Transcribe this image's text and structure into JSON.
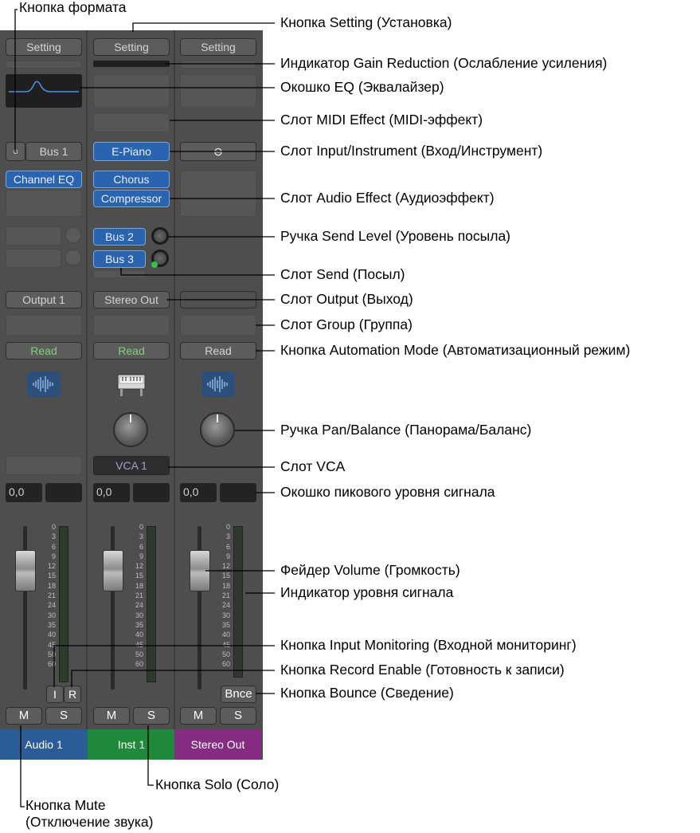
{
  "strips": [
    {
      "setting": "Setting",
      "input_toggle": "○",
      "input": "Bus 1",
      "audio_effects": [
        "Channel EQ"
      ],
      "sends": [],
      "output": "Output 1",
      "automation": "Read",
      "peak": "0,0",
      "input_monitor": "I",
      "record_enable": "R",
      "mute": "M",
      "solo": "S",
      "name": "Audio 1",
      "name_color": "#2b5c97",
      "icon": "waveform-icon"
    },
    {
      "setting": "Setting",
      "input": "E-Piano",
      "audio_effects": [
        "Chorus",
        "Compressor"
      ],
      "sends": [
        "Bus 2",
        "Bus 3"
      ],
      "output": "Stereo Out",
      "automation": "Read",
      "vca": "VCA 1",
      "peak": "0,0",
      "mute": "M",
      "solo": "S",
      "name": "Inst 1",
      "name_color": "#1f8a3a",
      "icon": "piano-icon"
    },
    {
      "setting": "Setting",
      "input": "⊖",
      "output": "",
      "automation": "Read",
      "peak": "0,0",
      "bounce": "Bnce",
      "mute": "M",
      "solo": "S",
      "name": "Stereo Out",
      "name_color": "#862c82",
      "icon": "waveform-icon"
    }
  ],
  "meter_scale": [
    "0",
    "3",
    "6",
    "9",
    "12",
    "15",
    "18",
    "21",
    "24",
    "30",
    "35",
    "40",
    "45",
    "50",
    "60"
  ],
  "callouts": {
    "format": "Кнопка формата",
    "setting": "Кнопка Setting (Установка)",
    "gain_reduction": "Индикатор Gain Reduction (Ослабление усиления)",
    "eq": "Окошко EQ (Эквалайзер)",
    "midi_effect": "Слот MIDI Effect (MIDI-эффект)",
    "input": "Слот Input/Instrument (Вход/Инструмент)",
    "audio_effect": "Слот Audio Effect (Аудиоэффект)",
    "send_level": "Ручка Send Level (Уровень посыла)",
    "send": "Слот Send (Посыл)",
    "output": "Слот Output (Выход)",
    "group": "Слот Group (Группа)",
    "automation": "Кнопка Automation Mode (Автоматизационный режим)",
    "pan": "Ручка Pan/Balance (Панорама/Баланс)",
    "vca": "Слот VCA",
    "peak": "Окошко пикового уровня сигнала",
    "volume": "Фейдер Volume (Громкость)",
    "level_meter": "Индикатор уровня сигнала",
    "input_monitoring": "Кнопка Input Monitoring (Входной мониторинг)",
    "record_enable": "Кнопка Record Enable (Готовность к записи)",
    "bounce": "Кнопка Bounce (Сведение)",
    "solo": "Кнопка Solo (Соло)",
    "mute_line1": "Кнопка Mute",
    "mute_line2": "(Отключение звука)"
  }
}
